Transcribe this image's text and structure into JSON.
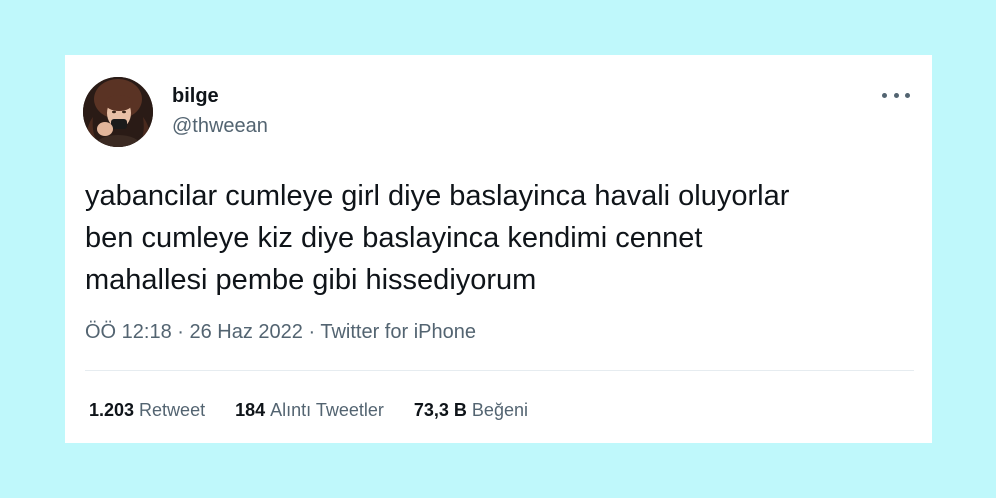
{
  "colors": {
    "background": "#bff8fb",
    "card": "#ffffff",
    "text": "#0f1419",
    "secondary": "#536471"
  },
  "user": {
    "name": "bilge",
    "handle": "@thweean",
    "avatar_icon": "user-avatar-photo"
  },
  "tweet": {
    "lines": [
      "yabancilar cumleye girl diye baslayinca havali oluyorlar",
      "ben cumleye kiz diye baslayinca kendimi cennet",
      "mahallesi pembe gibi hissediyorum"
    ],
    "time": "ÖÖ 12:18",
    "separator": "·",
    "date": "26 Haz 2022",
    "source": "Twitter for iPhone"
  },
  "stats": {
    "retweets": {
      "count": "1.203",
      "label": "Retweet"
    },
    "quotes": {
      "count": "184",
      "label": "Alıntı Tweetler"
    },
    "likes": {
      "count": "73,3 B",
      "label": "Beğeni"
    }
  },
  "more_icon": "more-horizontal-icon"
}
